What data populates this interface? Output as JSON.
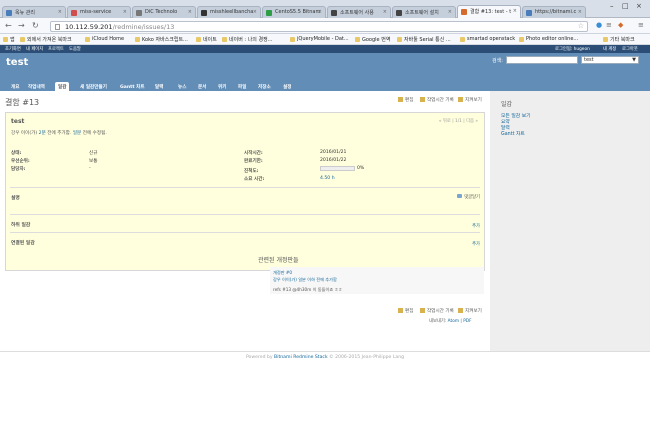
{
  "browser": {
    "tabs": [
      {
        "label": "옥뉴 관리",
        "color": "#4a7ebb",
        "active": false
      },
      {
        "label": "miss-service",
        "color": "#d04d4d",
        "active": false
      },
      {
        "label": "DiC Technolo",
        "color": "#777777",
        "active": false
      },
      {
        "label": "misshleellbancha",
        "color": "#333333",
        "active": false
      },
      {
        "label": "CentoS5.5 Bitnam",
        "color": "#2e9e46",
        "active": false
      },
      {
        "label": "소프트웨어 사용",
        "color": "#444444",
        "active": false
      },
      {
        "label": "소프트웨어 설치",
        "color": "#444444",
        "active": false
      },
      {
        "label": "결함 #13: test - t",
        "color": "#d46a2b",
        "active": true
      },
      {
        "label": "https://bitnami.c",
        "color": "#4a7ebb",
        "active": false
      }
    ],
    "url_host": "10.112.59.201",
    "url_path": "/redmine/issues/13",
    "bookmarks": [
      "앱",
      "외에서 가져온 북마크",
      "iCloud Home",
      "Koko 자바스크립트...",
      "네이트",
      "네이버 : 나의 경쟁...",
      "jQueryMobile - Dat...",
      "Google 번역",
      "자바툴 Serial 통신 ...",
      "smartad openstack",
      "Photo editor online...",
      "기타 북마크"
    ]
  },
  "top_menu": {
    "left": [
      "초기화면",
      "내 페이지",
      "프로젝트",
      "도움말"
    ],
    "right": [
      "로그인됨: hugeon",
      "내 계정",
      "로그아웃"
    ]
  },
  "header": {
    "project_title": "test",
    "search_label": "검색:",
    "project_select": "test"
  },
  "main_menu": [
    "개요",
    "작업내역",
    "일감",
    "새 일감만들기",
    "Gantt 차트",
    "달력",
    "뉴스",
    "문서",
    "위키",
    "파일",
    "저장소",
    "설정"
  ],
  "selected_menu_index": 2,
  "issue": {
    "title": "결함 #13",
    "actions": [
      "편집",
      "작업시간 기록",
      "지켜보기"
    ],
    "subject": "test",
    "nav": "« 뒤로 | 1/1 | 다음 »",
    "author_prefix": "강우 이이(가)",
    "author_created": "2분",
    "author_mid": "전에 추가함.",
    "author_updated": "일분",
    "author_suffix": "전에 수정됨.",
    "attributes_left": [
      {
        "label": "상태:",
        "value": "신규"
      },
      {
        "label": "우선순위:",
        "value": "보통"
      },
      {
        "label": "담당자:",
        "value": "-"
      }
    ],
    "attributes_right": [
      {
        "label": "시작시간:",
        "value": "2016/01/21"
      },
      {
        "label": "완료기한:",
        "value": "2016/01/22"
      },
      {
        "label": "진척도:",
        "value": "0%"
      },
      {
        "label": "소요 시간:",
        "value": "4.50 h"
      }
    ],
    "progress_pct": 0,
    "description_title": "설명",
    "quote_label": "댓글달기",
    "subtasks_title": "하위 일감",
    "subtasks_add": "추가",
    "related_title": "연결된 일감",
    "related_add": "추가"
  },
  "history": {
    "title": "관련된 개정판들",
    "entries": [
      "개정판 #0",
      "강우 이이(가) 일분 이하 전에 추가함",
      "refs #13 @4h30m 이 동들이죠 ㅎㅎ"
    ]
  },
  "bottom_actions": [
    "편집",
    "작업시간 기록",
    "지켜보기"
  ],
  "export": {
    "label": "내보내기:",
    "atom": "Atom",
    "pdf": "PDF"
  },
  "sidebar": {
    "title": "일감",
    "links": [
      "모든 일감 보기",
      "요약",
      "달력",
      "Gantt 차트"
    ]
  },
  "footer": {
    "prefix": "Powered by",
    "link": "Bitnami Redmine Stack",
    "suffix": "© 2006-2015 Jean-Philippe Lang"
  }
}
